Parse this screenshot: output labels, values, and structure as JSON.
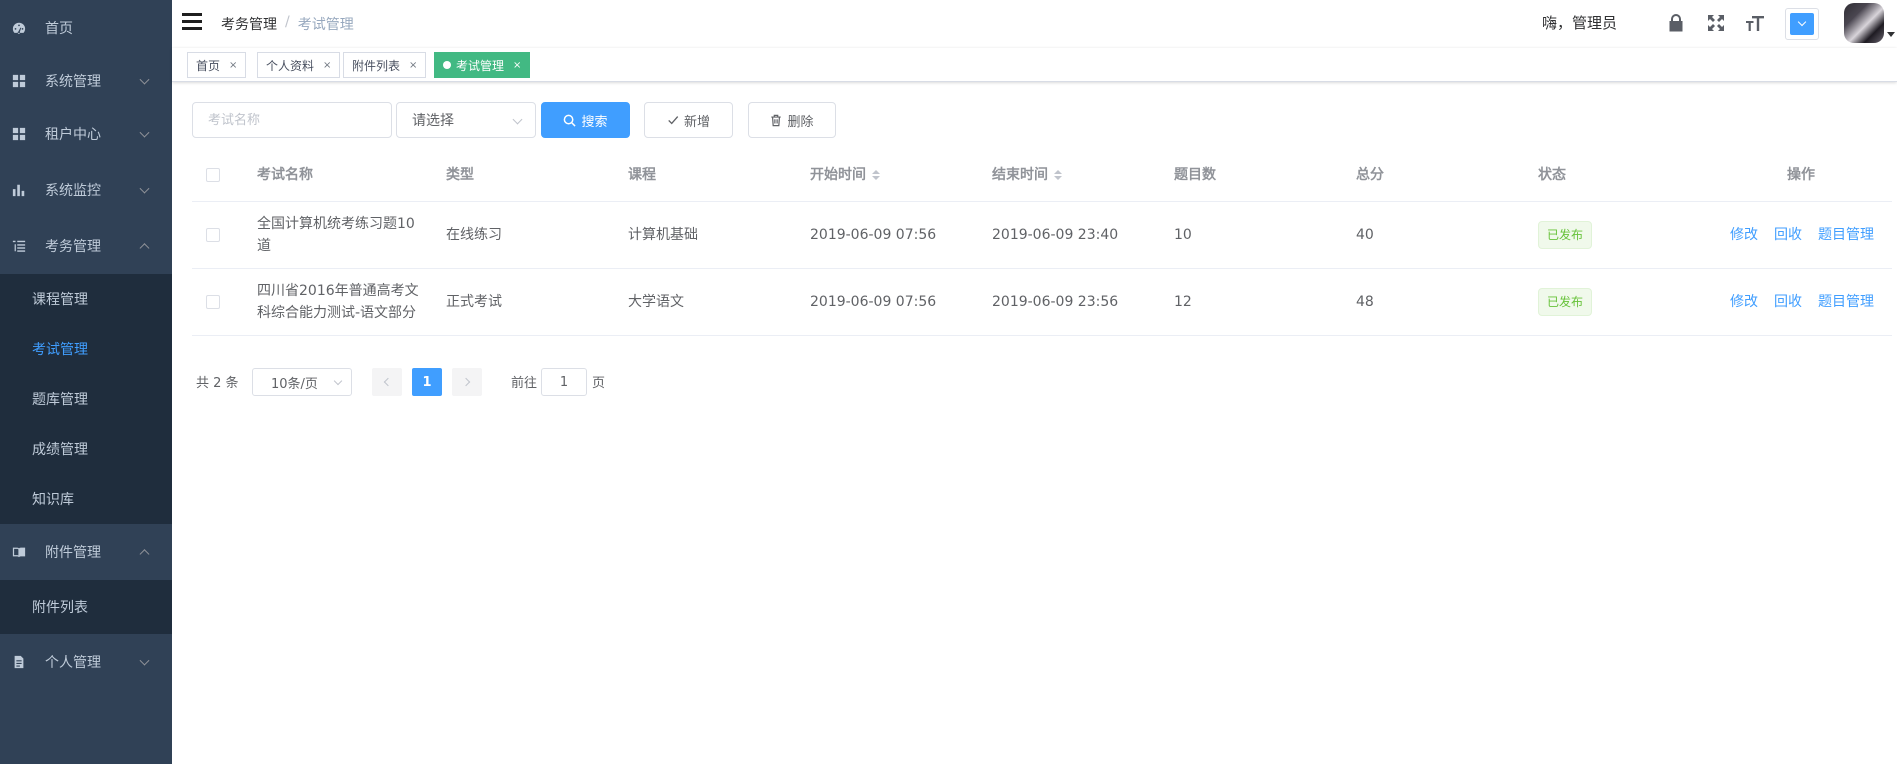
{
  "sidebar": {
    "items": [
      {
        "label": "首页",
        "icon": "dashboard-icon"
      },
      {
        "label": "系统管理",
        "icon": "grid-icon"
      },
      {
        "label": "租户中心",
        "icon": "grid-icon"
      },
      {
        "label": "系统监控",
        "icon": "bar-chart-icon"
      },
      {
        "label": "考务管理",
        "icon": "tree-list-icon"
      },
      {
        "label": "附件管理",
        "icon": "book-icon"
      },
      {
        "label": "个人管理",
        "icon": "document-icon"
      }
    ],
    "exam_submenu": [
      "课程管理",
      "考试管理",
      "题库管理",
      "成绩管理",
      "知识库"
    ],
    "attachment_submenu": [
      "附件列表"
    ],
    "active_item": "考试管理",
    "colors": {
      "background": "#304156",
      "submenu_background": "#1f2d3d",
      "text": "#bfcbd9",
      "active": "#409eff"
    }
  },
  "navbar": {
    "breadcrumb": [
      "考务管理",
      "考试管理"
    ],
    "breadcrumb_sep": "/",
    "greeting": "嗨，管理员",
    "icons": [
      "lock-icon",
      "fullscreen-icon",
      "font-size-icon",
      "theme-picker-icon",
      "avatar"
    ]
  },
  "tags": [
    {
      "label": "首页",
      "active": false
    },
    {
      "label": "个人资料",
      "active": false
    },
    {
      "label": "附件列表",
      "active": false
    },
    {
      "label": "考试管理",
      "active": true
    }
  ],
  "tag_close": "×",
  "toolbar": {
    "name_placeholder": "考试名称",
    "type_select_placeholder": "请选择",
    "search_label": "搜索",
    "add_label": "新增",
    "delete_label": "删除"
  },
  "table": {
    "columns": [
      "考试名称",
      "类型",
      "课程",
      "开始时间",
      "结束时间",
      "题目数",
      "总分",
      "状态",
      "操作"
    ],
    "rows": [
      {
        "name_line1": "全国计算机统考练习题10",
        "name_line2": "道",
        "type": "在线练习",
        "course": "计算机基础",
        "start": "2019-06-09 07:56",
        "end": "2019-06-09 23:40",
        "questions": "10",
        "total": "40",
        "status": "已发布"
      },
      {
        "name_line1": "四川省2016年普通高考文",
        "name_line2": "科综合能力测试-语文部分",
        "type": "正式考试",
        "course": "大学语文",
        "start": "2019-06-09 07:56",
        "end": "2019-06-09 23:56",
        "questions": "12",
        "total": "48",
        "status": "已发布"
      }
    ],
    "actions": [
      "修改",
      "回收",
      "题目管理"
    ]
  },
  "pagination": {
    "total_text": "共 2 条",
    "page_size": "10条/页",
    "current_page": "1",
    "goto_label": "前往",
    "goto_value": "1",
    "page_unit": "页"
  },
  "colors": {
    "primary": "#409eff",
    "success": "#67c23a",
    "tag_active": "#42b983"
  }
}
